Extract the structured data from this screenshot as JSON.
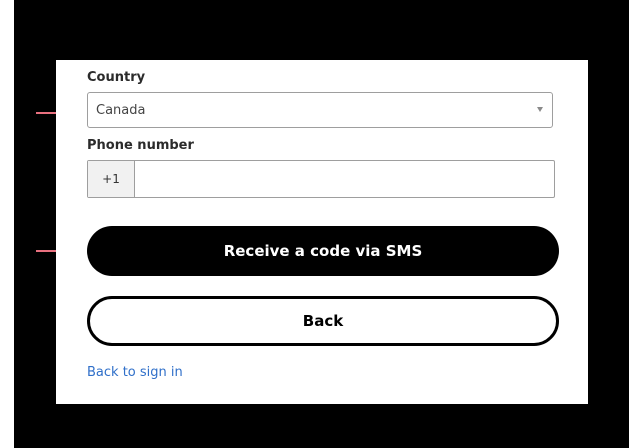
{
  "form": {
    "country_label": "Country",
    "country_value": "Canada",
    "phone_label": "Phone number",
    "phone_prefix": "+1",
    "phone_value": "",
    "sms_button": "Receive a code via SMS",
    "back_button": "Back",
    "sign_in_link": "Back to sign in"
  },
  "colors": {
    "annotation_arrow": "#e8707f",
    "link": "#2f6fc9",
    "primary_button": "#000000"
  },
  "icons": {
    "dropdown": "chevron-down-icon",
    "annotation": "arrow-right-icon"
  }
}
